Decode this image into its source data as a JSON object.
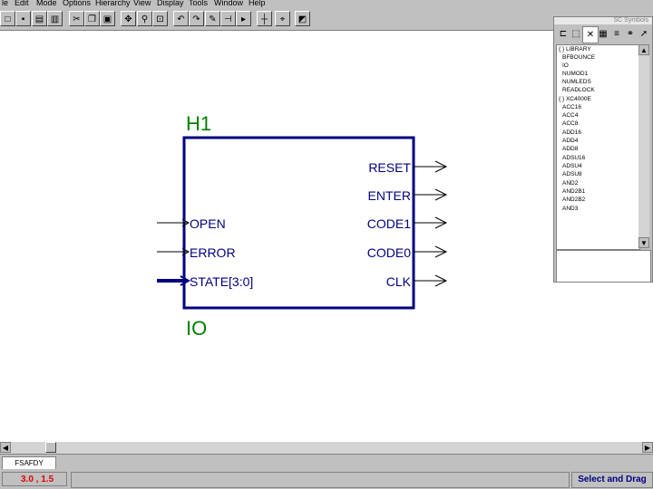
{
  "menu": [
    "le",
    "Edit",
    "Mode",
    "Options",
    "Hierarchy",
    "View",
    "Display",
    "Tools",
    "Window",
    "Help"
  ],
  "toolbar": {
    "buttons": [
      "new",
      "save",
      "print-preview",
      "print",
      "cut",
      "copy",
      "paste",
      "zoom-in",
      "zoom-area",
      "zoom-box",
      "undo",
      "redo",
      "pen",
      "bus",
      "pin",
      "net",
      "window"
    ]
  },
  "schematic": {
    "instance_name": "H1",
    "type_name": "IO",
    "inputs": [
      "OPEN",
      "ERROR",
      "STATE[3:0]"
    ],
    "outputs": [
      "RESET",
      "ENTER",
      "CODE1",
      "CODE0",
      "CLK"
    ],
    "colors": {
      "block": "#000080",
      "label": "#008000",
      "wire": "#000000"
    }
  },
  "symbols_panel": {
    "title": "SC Symbols",
    "items": [
      "{ } LIBRARY",
      "BFBOUNCE",
      "IO",
      "NUMOD1",
      "NUMLEDS",
      "READLOCK",
      "{ } XC4000E",
      "ACC16",
      "ACC4",
      "ACC8",
      "ADD16",
      "ADD4",
      "ADD8",
      "ADSU16",
      "ADSU4",
      "ADSU8",
      "AND2",
      "AND2B1",
      "AND2B2",
      "AND3"
    ]
  },
  "sheet_tab": "FSAFDY",
  "status": {
    "coords": "3.0 , 1.5",
    "mode": "Select and Drag"
  }
}
